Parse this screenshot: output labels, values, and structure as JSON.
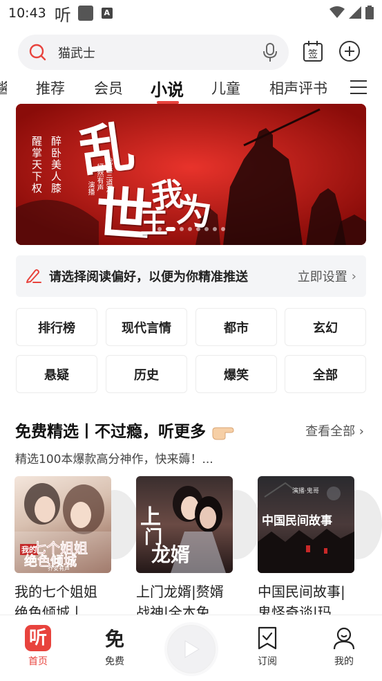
{
  "status_bar": {
    "time": "10:43",
    "ting_glyph": "听",
    "a_badge": "A"
  },
  "search": {
    "placeholder": "猫武士"
  },
  "header_icons": {
    "sign_label": "签"
  },
  "tabs": [
    {
      "label": "酱"
    },
    {
      "label": "推荐"
    },
    {
      "label": "会员"
    },
    {
      "label": "小说",
      "active": true
    },
    {
      "label": "儿童"
    },
    {
      "label": "相声评书"
    }
  ],
  "banner": {
    "tagline_left_1": "醒掌天下权",
    "tagline_left_2": "醉卧美人膝",
    "credit_1": "我是三道河",
    "credit_2": "嫣然有声",
    "credit_3": "演播",
    "slides": 8,
    "active_slide": 1
  },
  "preference": {
    "text": "请选择阅读偏好，以便为你精准推送",
    "link": "立即设置"
  },
  "categories": [
    {
      "label": "排行榜"
    },
    {
      "label": "现代言情"
    },
    {
      "label": "都市"
    },
    {
      "label": "玄幻"
    },
    {
      "label": "悬疑"
    },
    {
      "label": "历史"
    },
    {
      "label": "爆笑"
    },
    {
      "label": "全部"
    }
  ],
  "section": {
    "title": "免费精选丨不过瘾，听更多",
    "more": "查看全部",
    "subtitle": "精选100本爆款高分神作，快来薅！..."
  },
  "books": [
    {
      "title_line1": "我的七个姐姐",
      "title_line2": "绝色倾城丨",
      "cover_text_1": "我的",
      "cover_text_2": "七个姐姐",
      "cover_text_3": "绝色倾城",
      "cover_tag": "乔安有声"
    },
    {
      "title_line1": "上门龙婿|赘婿",
      "title_line2": "战神|全本免",
      "cover_text_1": "上",
      "cover_text_2": "门",
      "cover_text_3": "龙婿"
    },
    {
      "title_line1": "中国民间故事|",
      "title_line2": "鬼怪奇谈|玛",
      "cover_text_1": "中国民间故事",
      "cover_tag": "演播·鬼哥"
    }
  ],
  "bottom_nav": [
    {
      "label": "首页",
      "active": true,
      "icon_glyph": "听"
    },
    {
      "label": "免费",
      "icon_glyph": "免"
    },
    {
      "label": "订阅"
    },
    {
      "label": "我的"
    }
  ],
  "colors": {
    "accent": "#e8433d",
    "banner_red": "#c61713"
  }
}
